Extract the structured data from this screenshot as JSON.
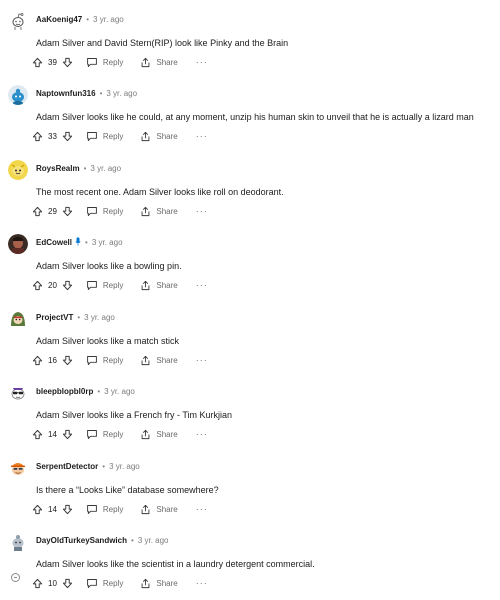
{
  "ui": {
    "separator": "•",
    "reply_label": "Reply",
    "share_label": "Share",
    "more_label": "···"
  },
  "comments": [
    {
      "username": "AaKoenig47",
      "time": "3 yr. ago",
      "text": "Adam Silver and David Stern(RIP) look like Pinky and the Brain",
      "score": "39",
      "avatar_icon": "outline-snoo-avatar"
    },
    {
      "username": "Naptownfun316",
      "time": "3 yr. ago",
      "text": "Adam Silver looks like he could, at any moment, unzip his human skin to unveil that he is actually a lizard man",
      "score": "33",
      "avatar_icon": "blue-snoo-avatar"
    },
    {
      "username": "RoysRealm",
      "time": "3 yr. ago",
      "text": "The most recent one. Adam Silver looks like roll on deodorant.",
      "score": "29",
      "avatar_icon": "yellow-snoo-avatar"
    },
    {
      "username": "EdCowell",
      "time": "3 yr. ago",
      "text": "Adam Silver looks like a bowling pin.",
      "score": "20",
      "avatar_icon": "photo-avatar",
      "badge_icon": "microphone-icon"
    },
    {
      "username": "ProjectVT",
      "time": "3 yr. ago",
      "text": "Adam Silver looks like a match stick",
      "score": "16",
      "avatar_icon": "hooded-snoo-avatar"
    },
    {
      "username": "bleepblopbl0rp",
      "time": "3 yr. ago",
      "text": "Adam Silver looks like a French fry - Tim Kurkjian",
      "score": "14",
      "avatar_icon": "sunglasses-snoo-avatar"
    },
    {
      "username": "SerpentDetector",
      "time": "3 yr. ago",
      "text": "Is there a “Looks Like” database somewhere?",
      "score": "14",
      "avatar_icon": "cap-snoo-avatar"
    },
    {
      "username": "DayOldTurkeySandwich",
      "time": "3 yr. ago",
      "text": "Adam Silver looks like the scientist in a laundry detergent commercial.",
      "score": "10",
      "avatar_icon": "grey-snoo-avatar"
    }
  ],
  "colors": {
    "text": "#1c1c1c",
    "muted": "#878a8c",
    "accent_blue": "#0079d3"
  }
}
